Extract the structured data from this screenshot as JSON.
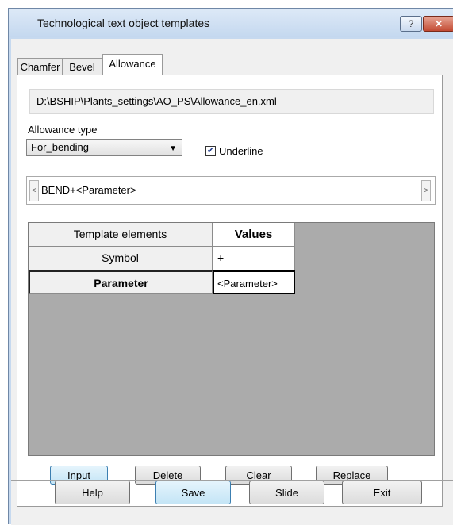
{
  "window": {
    "title": "Technological text object templates",
    "help_symbol": "?",
    "close_symbol": "✕"
  },
  "tabs": [
    {
      "label": "Chamfer"
    },
    {
      "label": "Bevel"
    },
    {
      "label": "Allowance",
      "active": true
    }
  ],
  "file_path": "D:\\BSHIP\\Plants_settings\\AO_PS\\Allowance_en.xml",
  "allowance_type": {
    "label": "Allowance type",
    "selected": "For_bending"
  },
  "underline": {
    "label": "Underline",
    "checked": true
  },
  "template_text": {
    "value": "BEND+<Parameter>",
    "left_arrow": "<",
    "right_arrow": ">"
  },
  "table": {
    "headers": [
      "Template elements",
      "Values"
    ],
    "rows": [
      {
        "element": "Symbol",
        "value": "+"
      },
      {
        "element": "Parameter",
        "value": "<Parameter>"
      }
    ]
  },
  "actions": {
    "input": "Input",
    "delete": "Delete",
    "clear": "Clear",
    "replace": "Replace"
  },
  "footer": {
    "help": "Help",
    "save": "Save",
    "slide": "Slide",
    "exit": "Exit"
  },
  "icons": {
    "dropdown": "chevron-down-icon",
    "check": "check-icon"
  },
  "colors": {
    "titlebar": "#c6d9ef",
    "close_button": "#c24a33",
    "check": "#223d8c"
  }
}
